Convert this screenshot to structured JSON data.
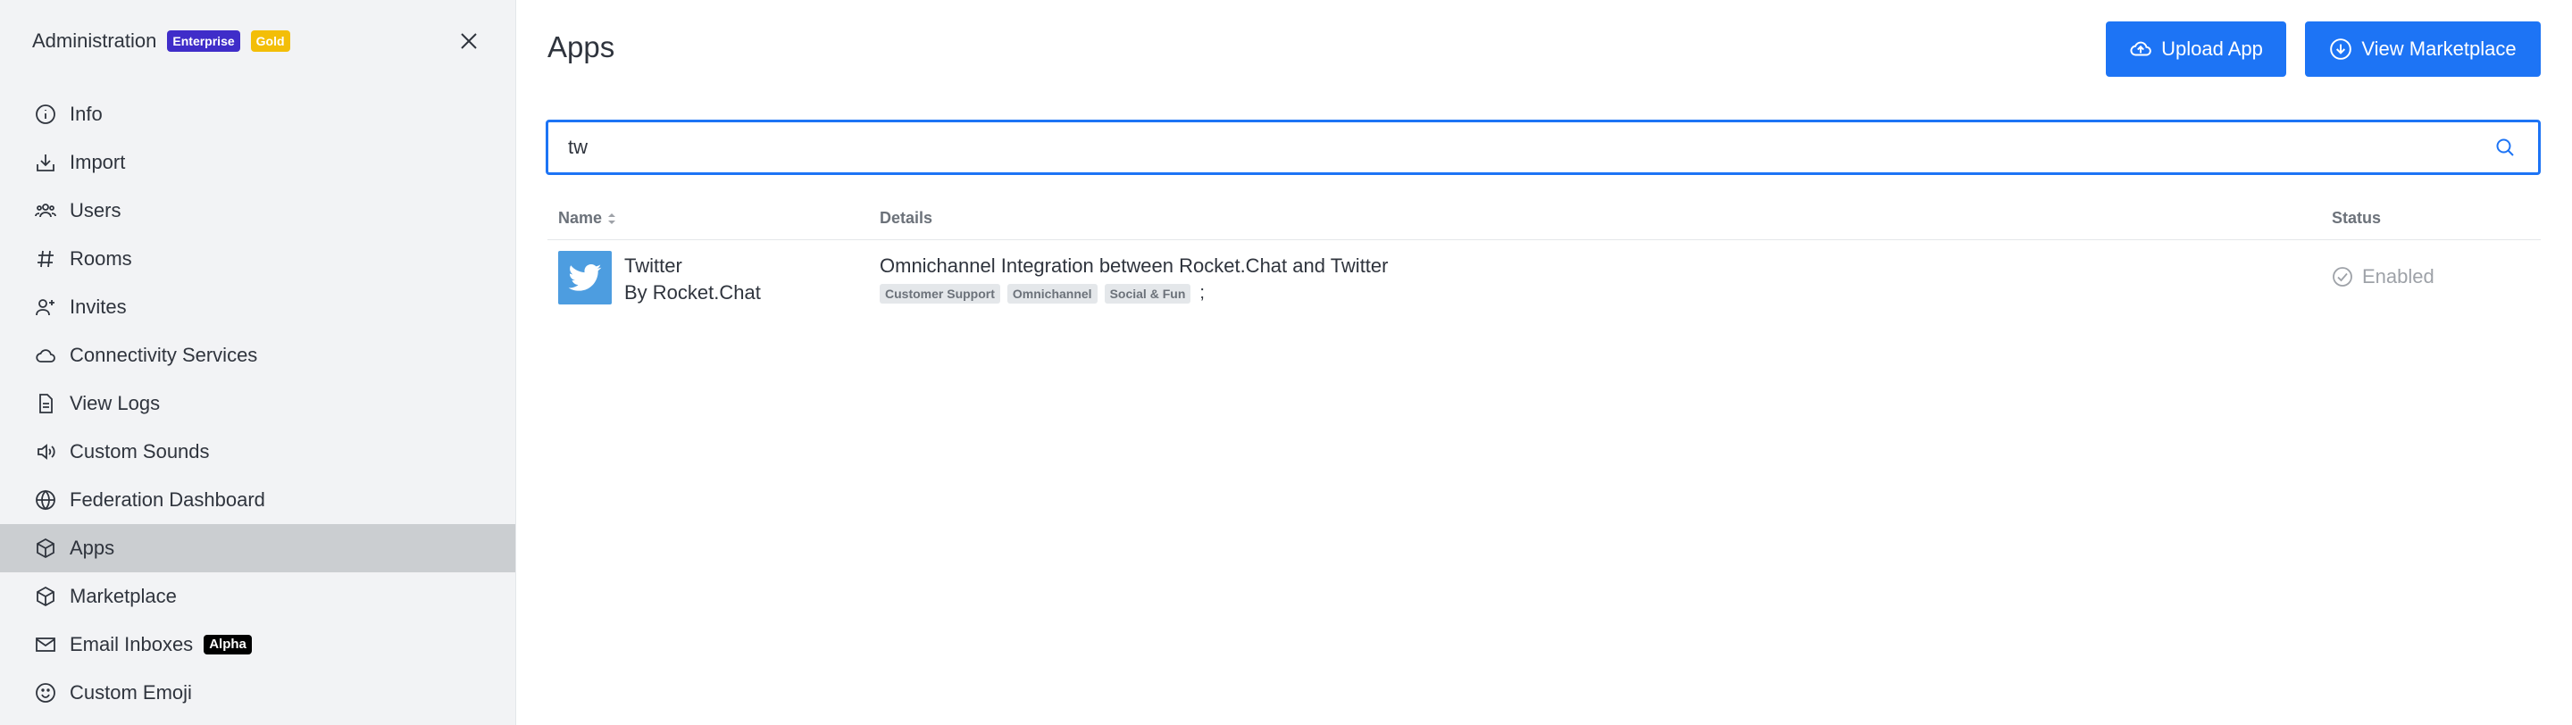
{
  "sidebar": {
    "title": "Administration",
    "badges": {
      "enterprise": "Enterprise",
      "gold": "Gold"
    },
    "items": [
      {
        "label": "Info",
        "icon": "info-icon"
      },
      {
        "label": "Import",
        "icon": "import-icon"
      },
      {
        "label": "Users",
        "icon": "users-icon"
      },
      {
        "label": "Rooms",
        "icon": "hashtag-icon"
      },
      {
        "label": "Invites",
        "icon": "user-plus-icon"
      },
      {
        "label": "Connectivity Services",
        "icon": "cloud-icon"
      },
      {
        "label": "View Logs",
        "icon": "document-icon"
      },
      {
        "label": "Custom Sounds",
        "icon": "speaker-icon"
      },
      {
        "label": "Federation Dashboard",
        "icon": "globe-icon"
      },
      {
        "label": "Apps",
        "icon": "cube-icon",
        "active": true
      },
      {
        "label": "Marketplace",
        "icon": "cube-icon"
      },
      {
        "label": "Email Inboxes",
        "icon": "mail-icon",
        "badge": "Alpha"
      },
      {
        "label": "Custom Emoji",
        "icon": "emoji-icon"
      }
    ]
  },
  "header": {
    "title": "Apps",
    "upload_label": "Upload App",
    "marketplace_label": "View Marketplace"
  },
  "search": {
    "value": "tw"
  },
  "table": {
    "columns": {
      "name": "Name",
      "details": "Details",
      "status": "Status"
    },
    "rows": [
      {
        "name": "Twitter",
        "author": "By Rocket.Chat",
        "description": "Omnichannel Integration between Rocket.Chat and Twitter",
        "categories": [
          "Customer Support",
          "Omnichannel",
          "Social & Fun"
        ],
        "separator": ";",
        "status": "Enabled"
      }
    ]
  },
  "colors": {
    "accent": "#1d74f5",
    "sidebar_bg": "#f2f3f5",
    "active_item_bg": "#cbced1",
    "enterprise_badge": "#3f2dc9",
    "gold_badge": "#f3be08"
  }
}
